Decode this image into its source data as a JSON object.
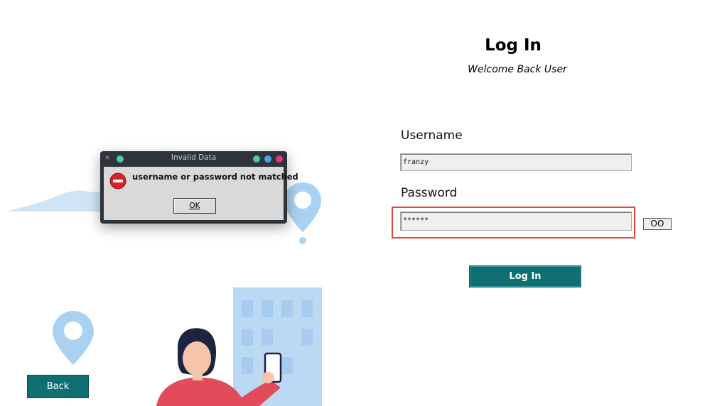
{
  "dialog": {
    "title": "Invalid Data",
    "message": "username or password not matched",
    "ok_label": "OK",
    "close_glyph": "✕",
    "icon": "error-stop-icon",
    "titlebar_dot_colors": [
      "#4ec9a0",
      "#4aa3e8",
      "#e2367a"
    ]
  },
  "header": {
    "title": "Log In",
    "subtitle": "Welcome Back User"
  },
  "form": {
    "username_label": "Username",
    "username_value": "franzy",
    "password_label": "Password",
    "password_value": "******",
    "show_password_label": "OO",
    "login_label": "Log In"
  },
  "back_label": "Back",
  "colors": {
    "accent": "#0e6f73",
    "highlight": "#e0463c",
    "illustration_blue": "#a9d2f2"
  }
}
